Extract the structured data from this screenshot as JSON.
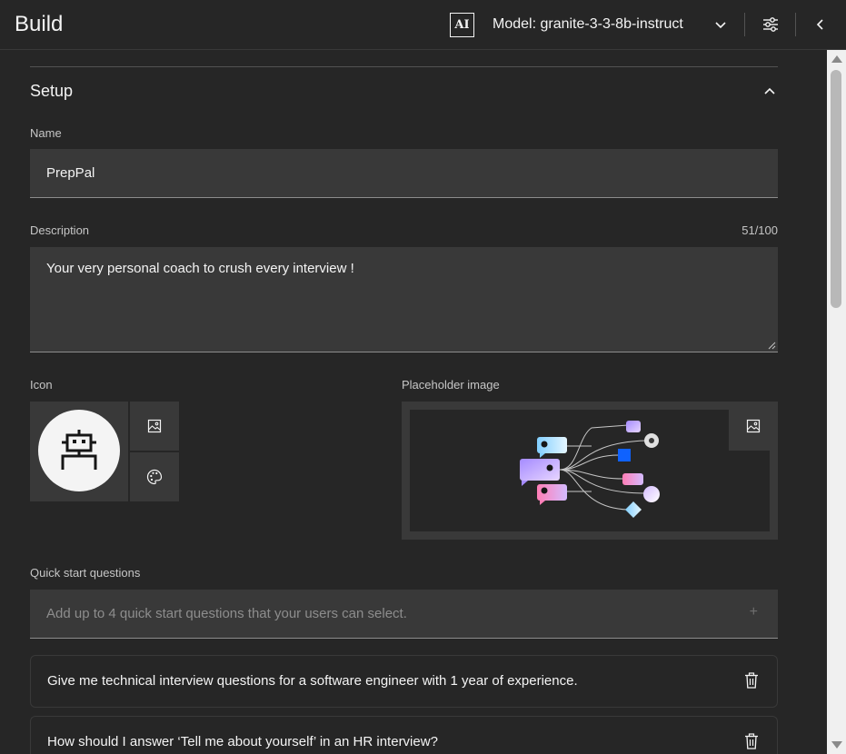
{
  "header": {
    "title": "Build",
    "ai_badge": "AI",
    "model_label": "Model: granite-3-3-8b-instruct",
    "icons": [
      "chevron-down-icon",
      "settings-sliders-icon",
      "chevron-left-icon"
    ]
  },
  "setup": {
    "title": "Setup",
    "name": {
      "label": "Name",
      "value": "PrepPal"
    },
    "description": {
      "label": "Description",
      "counter": "51/100",
      "value": "Your very personal coach to crush every interview !"
    },
    "icon": {
      "label": "Icon",
      "icon_name": "robot-icon",
      "buttons": [
        "image-upload-icon",
        "color-palette-icon"
      ]
    },
    "placeholder_image": {
      "label": "Placeholder image",
      "button_icon": "image-upload-icon"
    },
    "quick_start": {
      "label": "Quick start questions",
      "placeholder": "Add up to 4 quick start questions that your users can select.",
      "plus": "+",
      "questions": [
        "Give me technical interview questions for a software engineer with 1 year of experience.",
        "How should I answer ‘Tell me about yourself’ in an HR interview?"
      ]
    }
  },
  "colors": {
    "background": "#262626",
    "field": "#393939",
    "text": "#f4f4f4",
    "muted": "#c6c6c6"
  }
}
